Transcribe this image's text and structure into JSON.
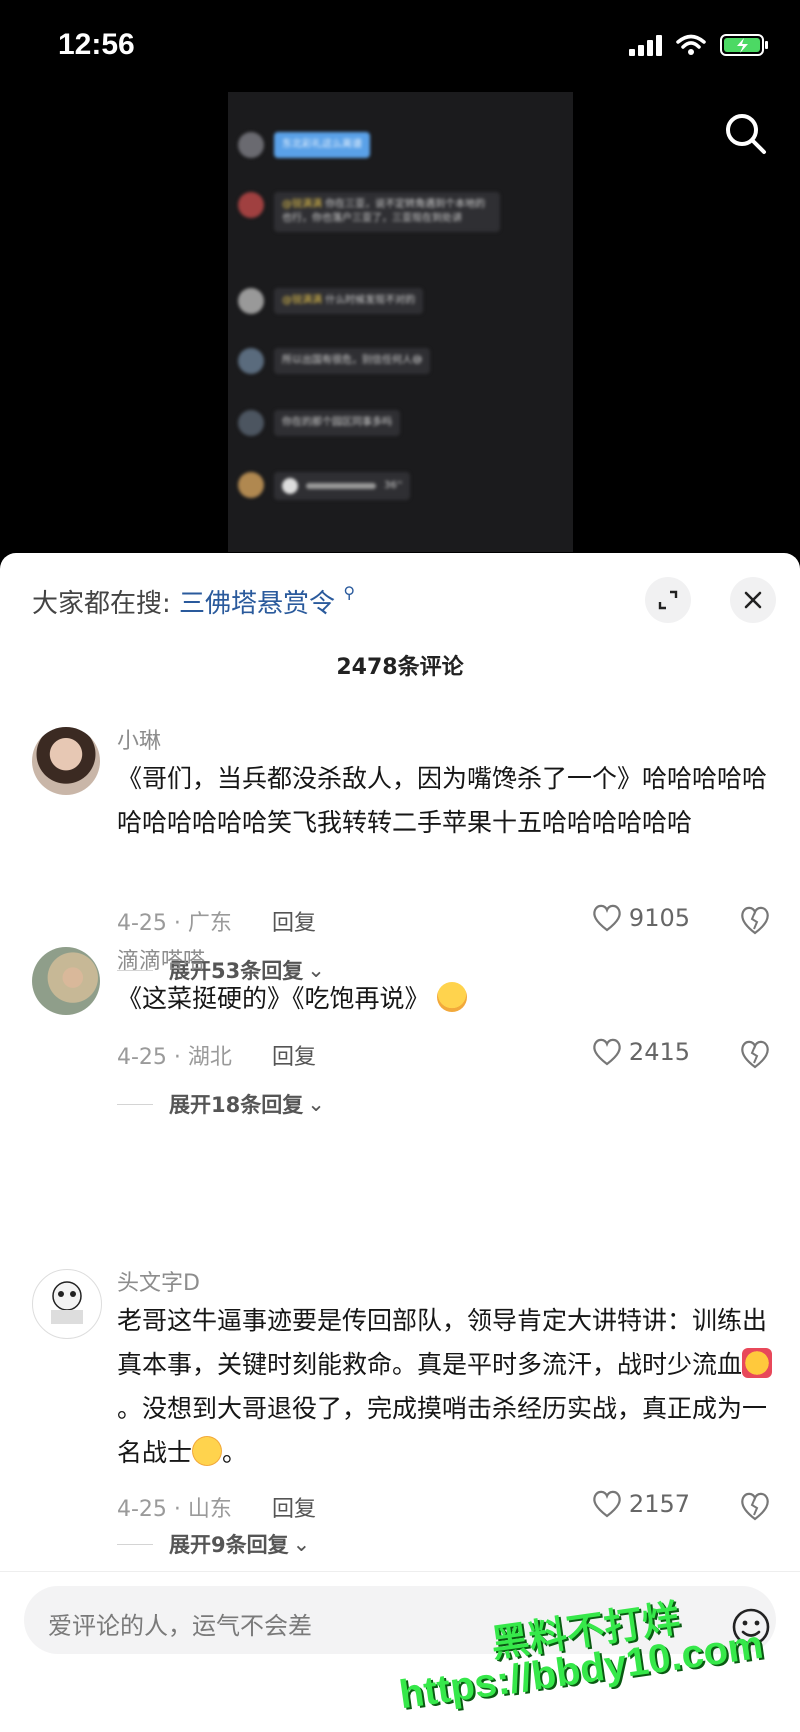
{
  "status": {
    "time": "12:56"
  },
  "video": {
    "chat": [
      {
        "text": "东北彩礼这么离谱",
        "style": "blue"
      },
      {
        "mention": "@锐满满",
        "text": "你在三亚，说不定转角遇到个本地的也行，你也落户三亚了，三亚现在到处讲"
      },
      {
        "mention": "@锐满满",
        "text": "什么时候发现不对的"
      },
      {
        "text": "所以出国有很危，别信任何人😅"
      },
      {
        "text": "你在的那个园区同事多吗"
      },
      {
        "text": "36''"
      }
    ]
  },
  "sheet": {
    "search_label": "大家都在搜:",
    "search_term": "三佛塔悬赏令",
    "comment_count": "2478条评论"
  },
  "comments": [
    {
      "name": "小琳",
      "text": "《哥们，当兵都没杀敌人，因为嘴馋杀了一个》哈哈哈哈哈哈哈哈哈哈哈笑飞我转转二手苹果十五哈哈哈哈哈哈",
      "meta": "4-25 · 广东",
      "reply": "回复",
      "likes": "9105",
      "expand": "展开53条回复"
    },
    {
      "name": "滴滴嗒嗒",
      "text": "《这菜挺硬的》《吃饱再说》",
      "meta": "4-25 · 湖北",
      "reply": "回复",
      "likes": "2415",
      "expand": "展开18条回复"
    },
    {
      "name": "头文字D",
      "text1": "老哥这牛逼事迹要是传回部队，领导肯定大讲特讲：训练出真本事，关键时刻能救命。真是平时多流汗，战时少流血",
      "text2": "。没想到大哥退役了，完成摸哨击杀经历实战，真正成为一名战士",
      "text3": "。",
      "meta": "4-25 · 山东",
      "reply": "回复",
      "likes": "2157",
      "expand": "展开9条回复"
    }
  ],
  "input": {
    "placeholder": "爱评论的人，运气不会差"
  },
  "watermark": {
    "line1": "黑料不打烊",
    "line2": "https://bbdy10.com"
  },
  "colors": {
    "accent_link": "#2a5a9c",
    "watermark": "#36e84a"
  }
}
